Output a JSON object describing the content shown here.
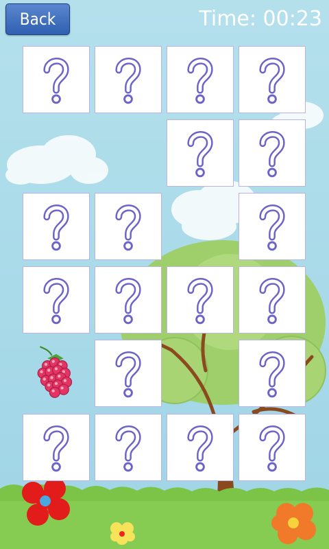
{
  "header": {
    "back_label": "Back",
    "timer_text": "Time: 00:23"
  },
  "colors": {
    "sky": "#a9dbe9",
    "grass": "#7bc447",
    "card_border": "#b9b3e6",
    "question_mark": "#6b63c8",
    "button": "#3b6bbf"
  },
  "board": {
    "rows": [
      [
        "hidden",
        "hidden",
        "hidden",
        "hidden"
      ],
      [
        "empty",
        "empty",
        "hidden",
        "hidden"
      ],
      [
        "hidden",
        "hidden",
        "empty",
        "hidden"
      ],
      [
        "hidden",
        "hidden",
        "hidden",
        "hidden"
      ],
      [
        "raspberry",
        "hidden",
        "empty",
        "hidden"
      ],
      [
        "hidden",
        "hidden",
        "hidden",
        "hidden"
      ]
    ]
  }
}
